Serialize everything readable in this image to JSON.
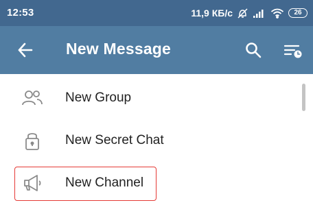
{
  "status_bar": {
    "time": "12:53",
    "speed": "11,9 КБ/с",
    "battery": "26"
  },
  "toolbar": {
    "title": "New Message",
    "color": "#517da2"
  },
  "menu": {
    "items": [
      {
        "label": "New Group",
        "icon": "group-icon"
      },
      {
        "label": "New Secret Chat",
        "icon": "lock-icon"
      },
      {
        "label": "New Channel",
        "icon": "megaphone-icon"
      }
    ]
  },
  "highlight_color": "#e53935"
}
